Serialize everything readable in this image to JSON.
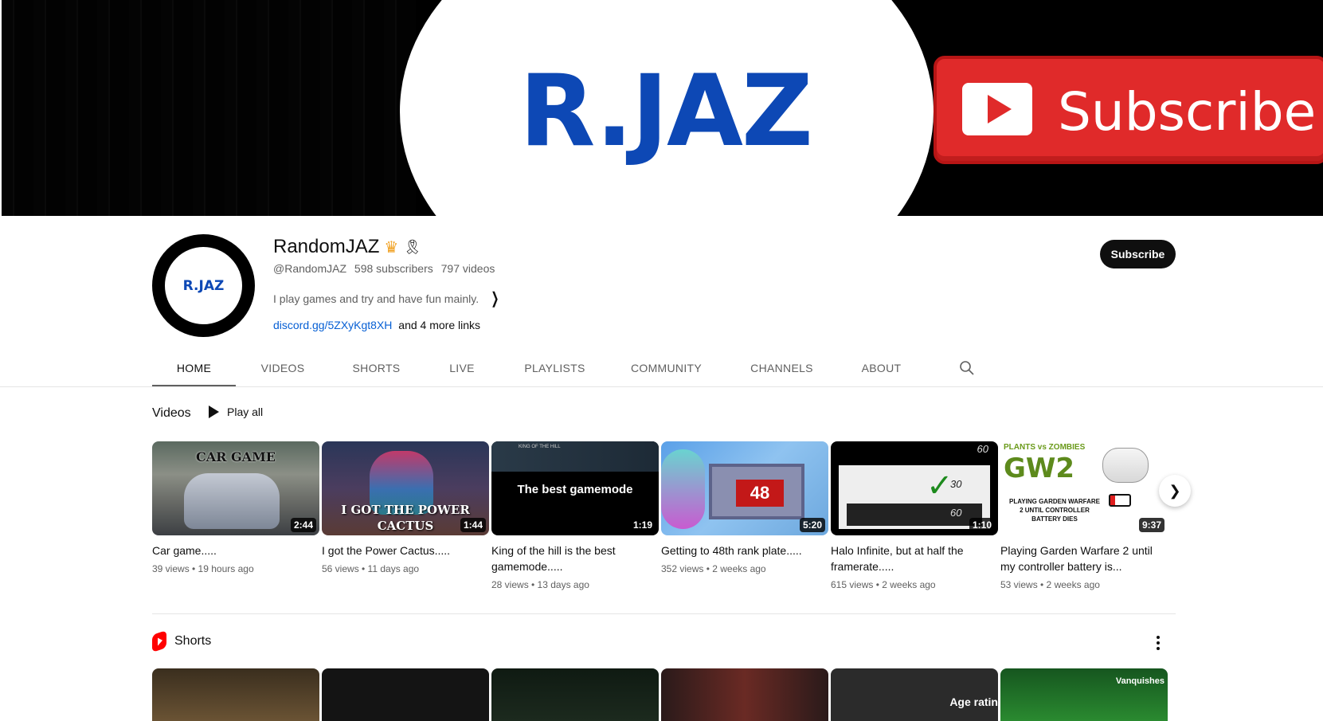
{
  "banner": {
    "logo_text": "R.JAZ",
    "subscribe_text": "Subscribe"
  },
  "channel": {
    "avatar_text": "R.JAZ",
    "name": "RandomJAZ",
    "crown_icon": "crown-icon",
    "ribbon_icon": "ribbon-icon",
    "handle": "@RandomJAZ",
    "subscribers": "598 subscribers",
    "videos_count": "797 videos",
    "description": "I play games and try and have fun mainly.",
    "link": "discord.gg/5ZXyKgt8XH",
    "more_links": "and 4 more links",
    "subscribe_label": "Subscribe"
  },
  "tabs": [
    {
      "label": "HOME",
      "active": true
    },
    {
      "label": "VIDEOS"
    },
    {
      "label": "SHORTS"
    },
    {
      "label": "LIVE"
    },
    {
      "label": "PLAYLISTS"
    },
    {
      "label": "COMMUNITY"
    },
    {
      "label": "CHANNELS"
    },
    {
      "label": "ABOUT"
    }
  ],
  "videos_shelf": {
    "title": "Videos",
    "play_all": "Play all",
    "items": [
      {
        "title": "Car game.....",
        "meta": "39 views • 19 hours ago",
        "duration": "2:44",
        "thumb_text": "CAR GAME"
      },
      {
        "title": "I got the Power Cactus.....",
        "meta": "56 views • 11 days ago",
        "duration": "1:44",
        "thumb_text": "I GOT THE POWER CACTUS"
      },
      {
        "title": "King of the hill is the best gamemode.....",
        "meta": "28 views • 13 days ago",
        "duration": "1:19",
        "thumb_text": "The best gamemode",
        "thumb_header": "KING OF THE HILL"
      },
      {
        "title": "Getting to 48th rank plate.....",
        "meta": "352 views • 2 weeks ago",
        "duration": "5:20",
        "thumb_text": "48"
      },
      {
        "title": "Halo Infinite, but at half the framerate.....",
        "meta": "615 views • 2 weeks ago",
        "duration": "1:10",
        "thumb_text_a": "60",
        "thumb_text_b": "30",
        "thumb_text_c": "60"
      },
      {
        "title": "Playing Garden Warfare 2 until my controller battery is...",
        "meta": "53 views • 2 weeks ago",
        "duration": "9:37",
        "thumb_text": "PLAYING GARDEN WARFARE 2 UNTIL CONTROLLER BATTERY DIES",
        "thumb_logo": "GW2",
        "thumb_logo_top": "PLANTS vs ZOMBIES"
      }
    ]
  },
  "shorts_shelf": {
    "title": "Shorts",
    "items": [
      {
        "overlay": ""
      },
      {
        "overlay": ""
      },
      {
        "overlay": ""
      },
      {
        "overlay": ""
      },
      {
        "overlay": "Age ratin"
      },
      {
        "overlay": "Vanquishes"
      }
    ]
  },
  "colors": {
    "brand_blue": "#0d48b5",
    "subscribe_red": "#e02a2a",
    "link_blue": "#065fd4"
  }
}
